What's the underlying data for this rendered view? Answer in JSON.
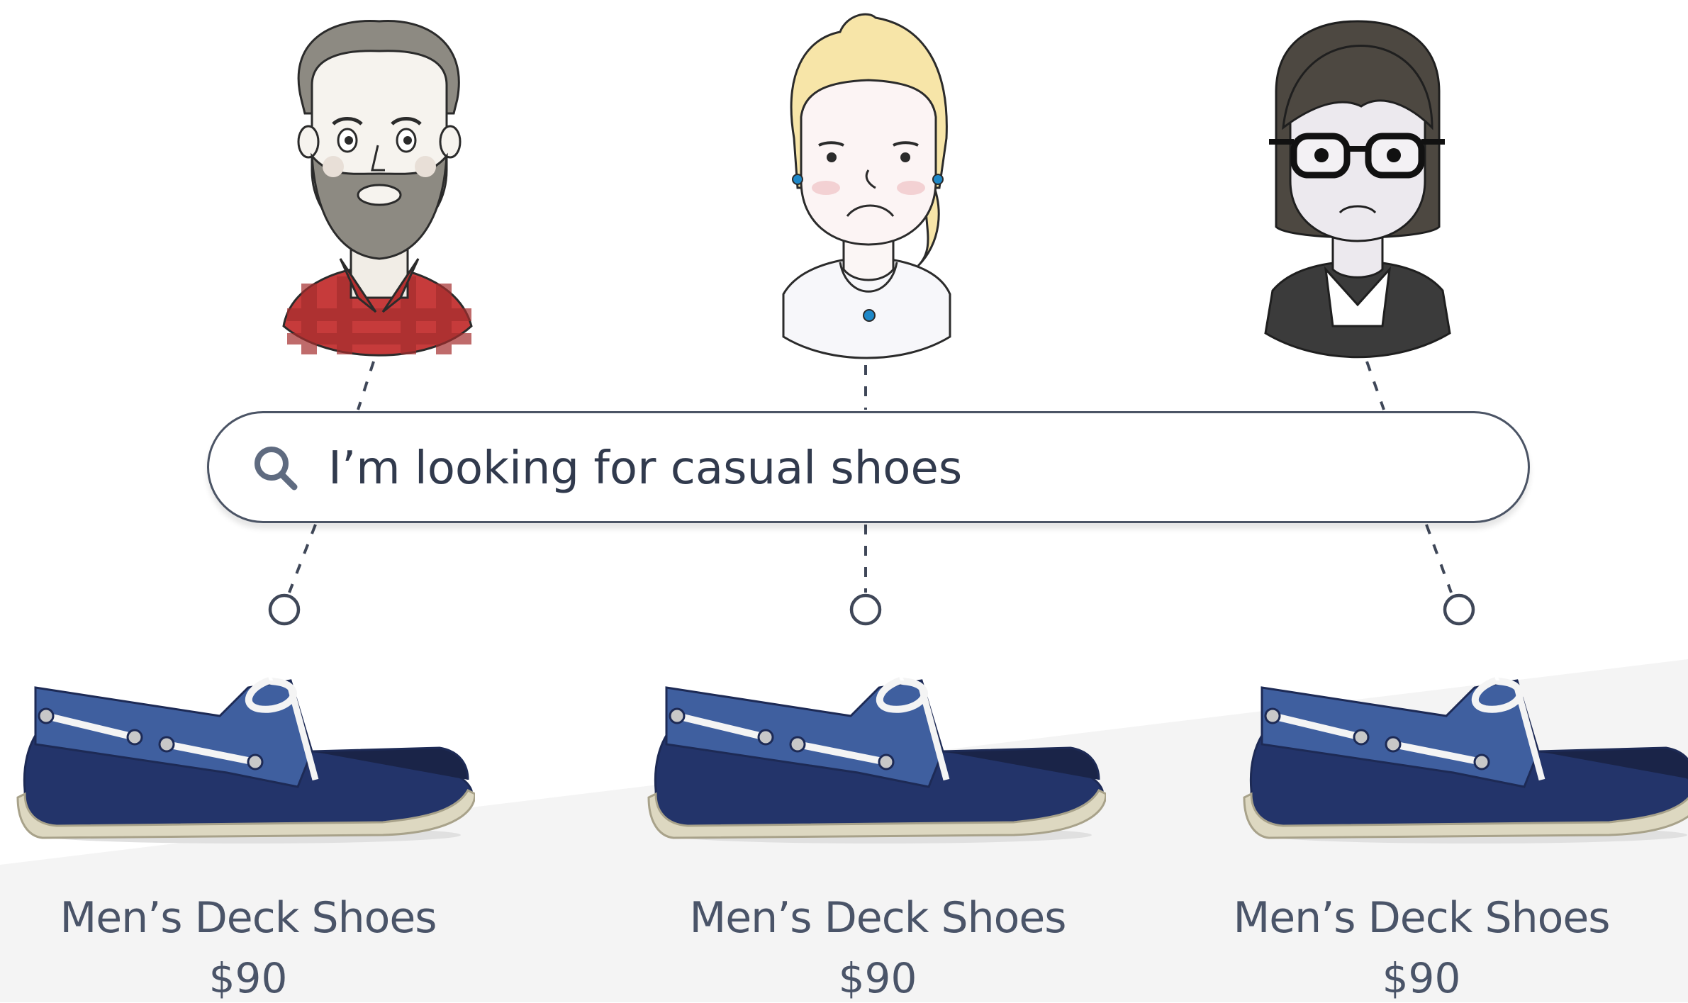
{
  "search": {
    "query": "I’m looking for casual shoes",
    "icon": "search-icon"
  },
  "personas": [
    {
      "name": "bearded-man-avatar",
      "icon": "bearded-man-avatar"
    },
    {
      "name": "blonde-woman-avatar",
      "icon": "blonde-woman-avatar"
    },
    {
      "name": "woman-with-glasses-avatar",
      "icon": "woman-with-glasses-avatar"
    }
  ],
  "products": [
    {
      "name": "Men’s Deck Shoes",
      "price": "$90"
    },
    {
      "name": "Men’s Deck Shoes",
      "price": "$90"
    },
    {
      "name": "Men’s Deck Shoes",
      "price": "$90"
    }
  ],
  "colors": {
    "text": "#4a5468",
    "line": "#3f4758",
    "shoe_navy": "#23346a",
    "shoe_blue": "#3f5f9f",
    "sole": "#ddd8c1"
  }
}
